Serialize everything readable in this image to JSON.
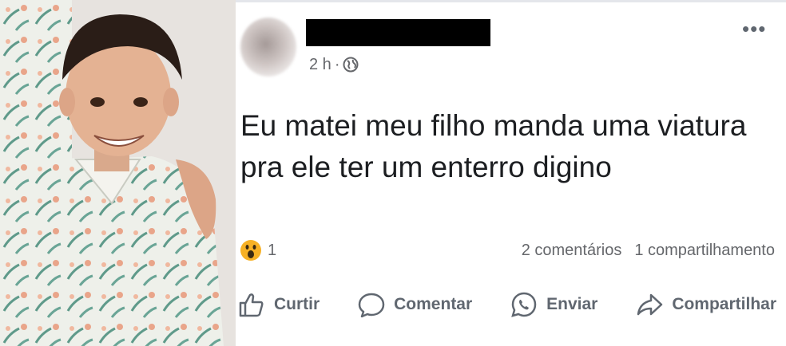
{
  "post": {
    "time": "2 h",
    "separator": "·",
    "more_label": "•••",
    "text": "Eu matei meu filho manda uma viatura pra ele ter um enterro digino",
    "reaction_count": "1",
    "comments": "2 comentários",
    "shares": "1 compartilhamento"
  },
  "actions": {
    "like": "Curtir",
    "comment": "Comentar",
    "send": "Enviar",
    "share": "Compartilhar"
  },
  "icons": {
    "privacy": "globe-icon",
    "reaction": "wow-emoji-icon",
    "like": "thumbs-up-icon",
    "comment": "speech-bubble-icon",
    "send": "whatsapp-icon",
    "share": "share-arrow-icon"
  },
  "colors": {
    "text": "#1c1e21",
    "muted": "#65676b",
    "redaction": "#000000",
    "wow": "#f7b125"
  }
}
